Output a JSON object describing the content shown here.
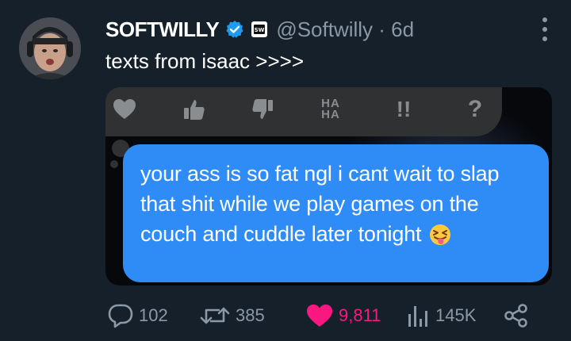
{
  "tweet": {
    "display_name": "SOFTWILLY",
    "handle_time": "@Softwilly · 6d",
    "text": "texts from isaac >>>>",
    "verified": true
  },
  "media": {
    "reactions": [
      "heart-icon",
      "thumbs-up-icon",
      "thumbs-down-icon",
      "haha-icon",
      "exclamation-icon",
      "question-icon"
    ],
    "haha_label": "HA HA",
    "exclaim_label": "!!",
    "question_label": "?",
    "message_text": "your ass is so fat ngl i cant wait to slap that shit while we play games on the couch and cuddle later tonight",
    "bubble_color": "#2f8cf7"
  },
  "actions": {
    "replies": "102",
    "retweets": "385",
    "likes": "9,811",
    "views": "145K",
    "like_color": "#f91880"
  }
}
